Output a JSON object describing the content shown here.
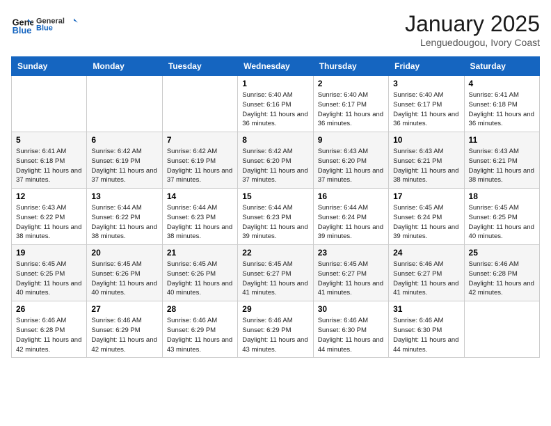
{
  "header": {
    "logo_line1": "General",
    "logo_line2": "Blue",
    "month": "January 2025",
    "location": "Lenguedougou, Ivory Coast"
  },
  "days_of_week": [
    "Sunday",
    "Monday",
    "Tuesday",
    "Wednesday",
    "Thursday",
    "Friday",
    "Saturday"
  ],
  "weeks": [
    {
      "row_class": "",
      "days": [
        {
          "num": "",
          "info": ""
        },
        {
          "num": "",
          "info": ""
        },
        {
          "num": "",
          "info": ""
        },
        {
          "num": "1",
          "info": "Sunrise: 6:40 AM\nSunset: 6:16 PM\nDaylight: 11 hours\nand 36 minutes."
        },
        {
          "num": "2",
          "info": "Sunrise: 6:40 AM\nSunset: 6:17 PM\nDaylight: 11 hours\nand 36 minutes."
        },
        {
          "num": "3",
          "info": "Sunrise: 6:40 AM\nSunset: 6:17 PM\nDaylight: 11 hours\nand 36 minutes."
        },
        {
          "num": "4",
          "info": "Sunrise: 6:41 AM\nSunset: 6:18 PM\nDaylight: 11 hours\nand 36 minutes."
        }
      ]
    },
    {
      "row_class": "alt-row",
      "days": [
        {
          "num": "5",
          "info": "Sunrise: 6:41 AM\nSunset: 6:18 PM\nDaylight: 11 hours\nand 37 minutes."
        },
        {
          "num": "6",
          "info": "Sunrise: 6:42 AM\nSunset: 6:19 PM\nDaylight: 11 hours\nand 37 minutes."
        },
        {
          "num": "7",
          "info": "Sunrise: 6:42 AM\nSunset: 6:19 PM\nDaylight: 11 hours\nand 37 minutes."
        },
        {
          "num": "8",
          "info": "Sunrise: 6:42 AM\nSunset: 6:20 PM\nDaylight: 11 hours\nand 37 minutes."
        },
        {
          "num": "9",
          "info": "Sunrise: 6:43 AM\nSunset: 6:20 PM\nDaylight: 11 hours\nand 37 minutes."
        },
        {
          "num": "10",
          "info": "Sunrise: 6:43 AM\nSunset: 6:21 PM\nDaylight: 11 hours\nand 38 minutes."
        },
        {
          "num": "11",
          "info": "Sunrise: 6:43 AM\nSunset: 6:21 PM\nDaylight: 11 hours\nand 38 minutes."
        }
      ]
    },
    {
      "row_class": "",
      "days": [
        {
          "num": "12",
          "info": "Sunrise: 6:43 AM\nSunset: 6:22 PM\nDaylight: 11 hours\nand 38 minutes."
        },
        {
          "num": "13",
          "info": "Sunrise: 6:44 AM\nSunset: 6:22 PM\nDaylight: 11 hours\nand 38 minutes."
        },
        {
          "num": "14",
          "info": "Sunrise: 6:44 AM\nSunset: 6:23 PM\nDaylight: 11 hours\nand 38 minutes."
        },
        {
          "num": "15",
          "info": "Sunrise: 6:44 AM\nSunset: 6:23 PM\nDaylight: 11 hours\nand 39 minutes."
        },
        {
          "num": "16",
          "info": "Sunrise: 6:44 AM\nSunset: 6:24 PM\nDaylight: 11 hours\nand 39 minutes."
        },
        {
          "num": "17",
          "info": "Sunrise: 6:45 AM\nSunset: 6:24 PM\nDaylight: 11 hours\nand 39 minutes."
        },
        {
          "num": "18",
          "info": "Sunrise: 6:45 AM\nSunset: 6:25 PM\nDaylight: 11 hours\nand 40 minutes."
        }
      ]
    },
    {
      "row_class": "alt-row",
      "days": [
        {
          "num": "19",
          "info": "Sunrise: 6:45 AM\nSunset: 6:25 PM\nDaylight: 11 hours\nand 40 minutes."
        },
        {
          "num": "20",
          "info": "Sunrise: 6:45 AM\nSunset: 6:26 PM\nDaylight: 11 hours\nand 40 minutes."
        },
        {
          "num": "21",
          "info": "Sunrise: 6:45 AM\nSunset: 6:26 PM\nDaylight: 11 hours\nand 40 minutes."
        },
        {
          "num": "22",
          "info": "Sunrise: 6:45 AM\nSunset: 6:27 PM\nDaylight: 11 hours\nand 41 minutes."
        },
        {
          "num": "23",
          "info": "Sunrise: 6:45 AM\nSunset: 6:27 PM\nDaylight: 11 hours\nand 41 minutes."
        },
        {
          "num": "24",
          "info": "Sunrise: 6:46 AM\nSunset: 6:27 PM\nDaylight: 11 hours\nand 41 minutes."
        },
        {
          "num": "25",
          "info": "Sunrise: 6:46 AM\nSunset: 6:28 PM\nDaylight: 11 hours\nand 42 minutes."
        }
      ]
    },
    {
      "row_class": "",
      "days": [
        {
          "num": "26",
          "info": "Sunrise: 6:46 AM\nSunset: 6:28 PM\nDaylight: 11 hours\nand 42 minutes."
        },
        {
          "num": "27",
          "info": "Sunrise: 6:46 AM\nSunset: 6:29 PM\nDaylight: 11 hours\nand 42 minutes."
        },
        {
          "num": "28",
          "info": "Sunrise: 6:46 AM\nSunset: 6:29 PM\nDaylight: 11 hours\nand 43 minutes."
        },
        {
          "num": "29",
          "info": "Sunrise: 6:46 AM\nSunset: 6:29 PM\nDaylight: 11 hours\nand 43 minutes."
        },
        {
          "num": "30",
          "info": "Sunrise: 6:46 AM\nSunset: 6:30 PM\nDaylight: 11 hours\nand 44 minutes."
        },
        {
          "num": "31",
          "info": "Sunrise: 6:46 AM\nSunset: 6:30 PM\nDaylight: 11 hours\nand 44 minutes."
        },
        {
          "num": "",
          "info": ""
        }
      ]
    }
  ]
}
